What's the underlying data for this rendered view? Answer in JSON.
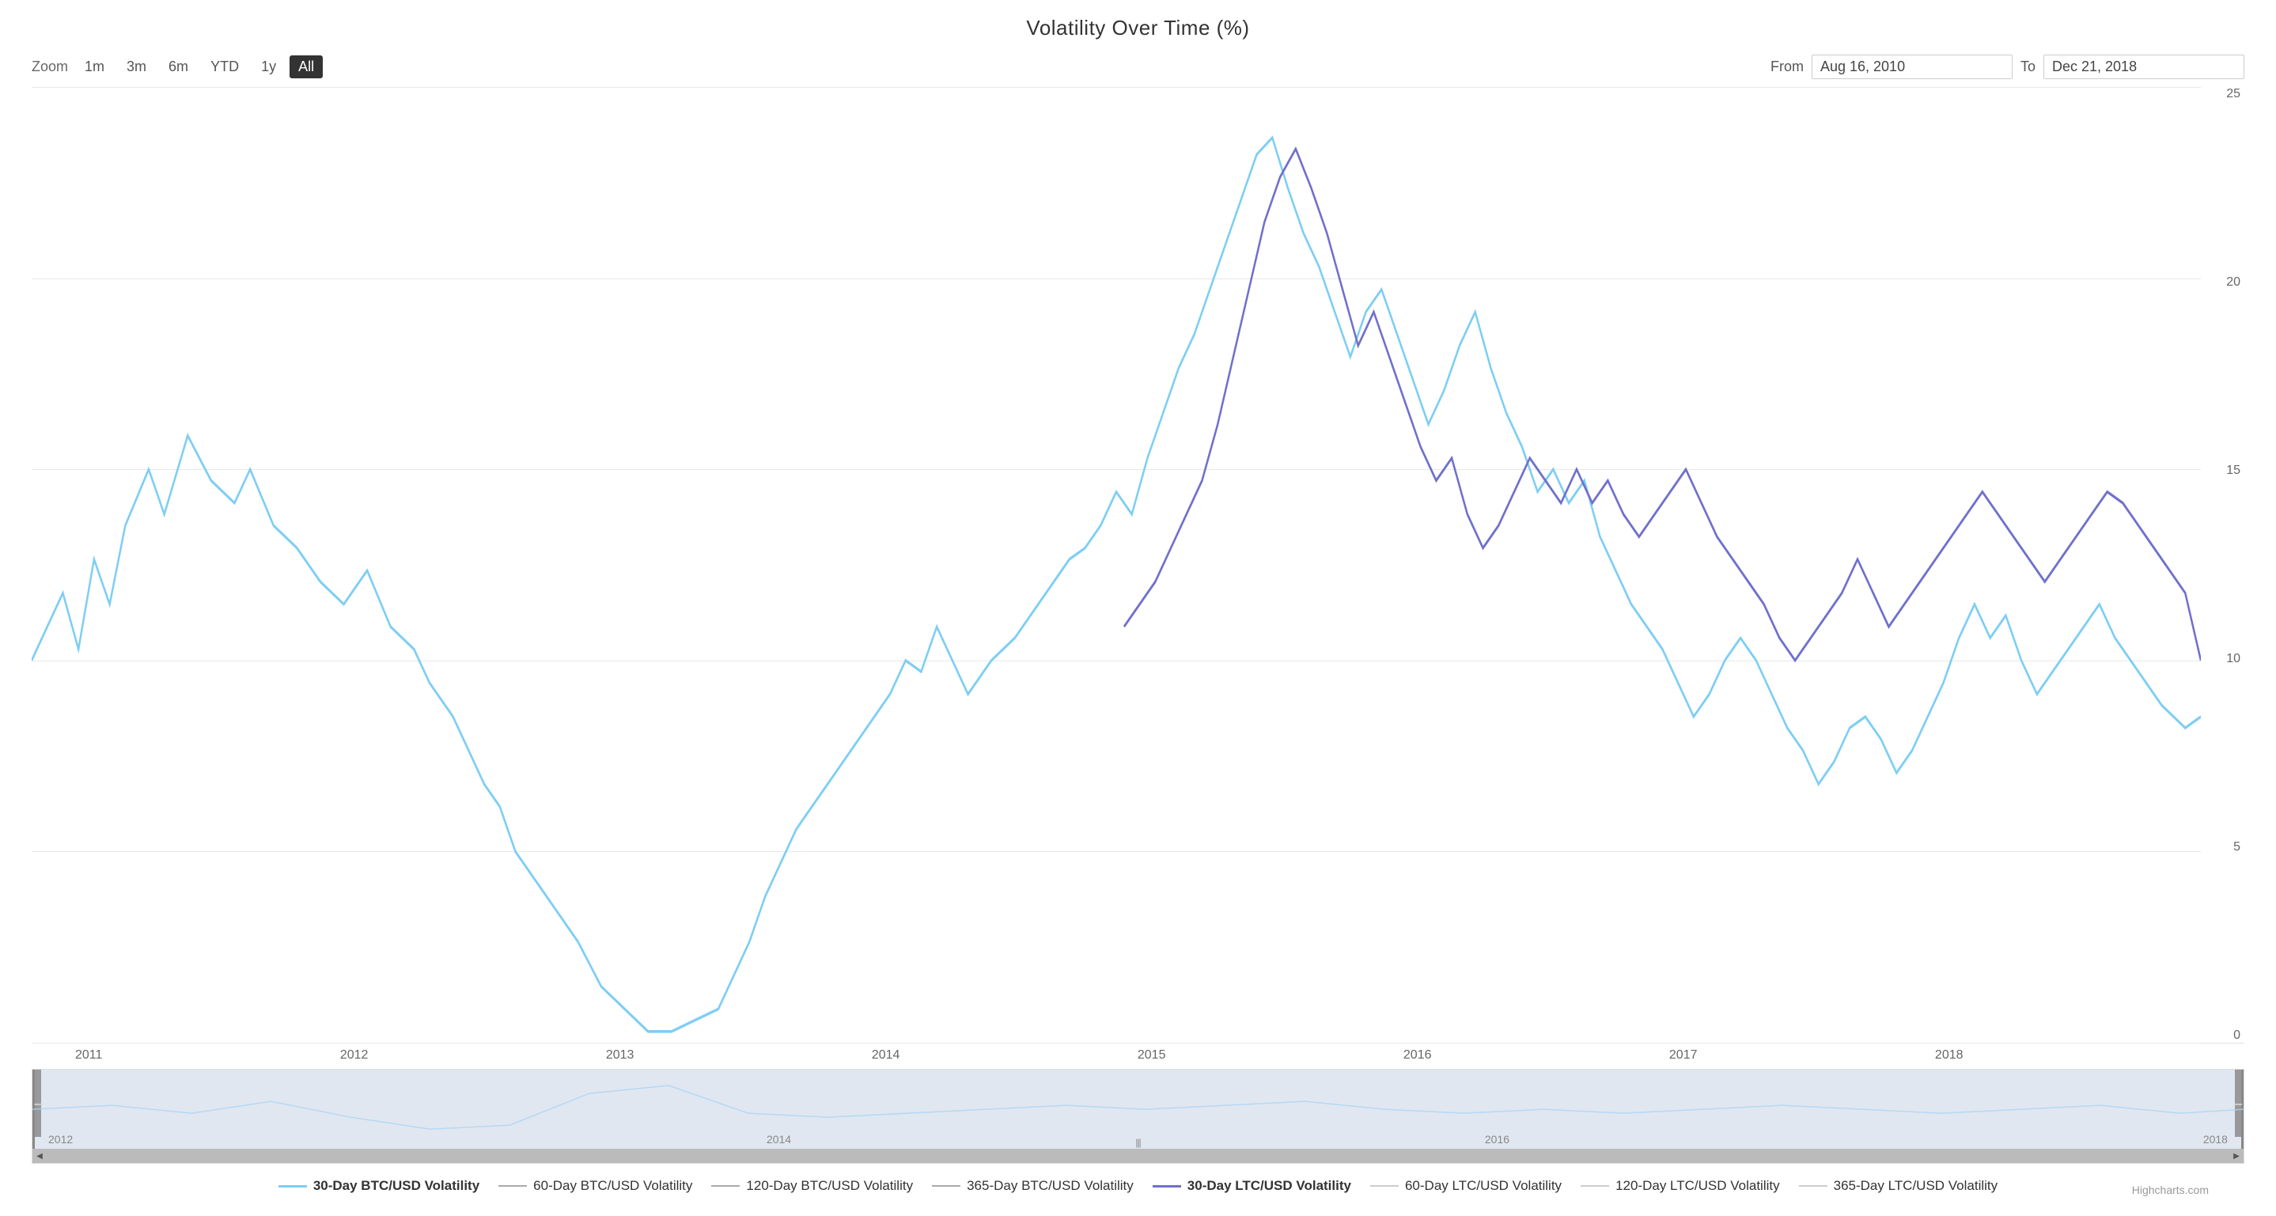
{
  "title": "Volatility Over Time (%)",
  "toolbar": {
    "zoom_label": "Zoom",
    "zoom_buttons": [
      "1m",
      "3m",
      "6m",
      "YTD",
      "1y",
      "All"
    ],
    "active_zoom": "All",
    "from_label": "From",
    "to_label": "To",
    "from_date": "Aug 16, 2010",
    "to_date": "Dec 21, 2018"
  },
  "y_axis": {
    "labels": [
      "25",
      "20",
      "15",
      "10",
      "5",
      "0"
    ]
  },
  "x_axis": {
    "labels": [
      "2011",
      "2012",
      "2013",
      "2014",
      "2015",
      "2016",
      "2017",
      "2018",
      ""
    ]
  },
  "navigator": {
    "x_labels": [
      "2012",
      "2014",
      "2016",
      "2018"
    ]
  },
  "legend": [
    {
      "id": "btc30",
      "label": "30-Day BTC/USD Volatility",
      "color": "#7ecef4",
      "bold": true
    },
    {
      "id": "btc60",
      "label": "60-Day BTC/USD Volatility",
      "color": "#aaaaaa",
      "bold": false
    },
    {
      "id": "btc120",
      "label": "120-Day BTC/USD Volatility",
      "color": "#aaaaaa",
      "bold": false
    },
    {
      "id": "btc365",
      "label": "365-Day BTC/USD Volatility",
      "color": "#aaaaaa",
      "bold": false
    },
    {
      "id": "ltc30",
      "label": "30-Day LTC/USD Volatility",
      "color": "#7070cc",
      "bold": true
    },
    {
      "id": "ltc60",
      "label": "60-Day LTC/USD Volatility",
      "color": "#cccccc",
      "bold": false
    },
    {
      "id": "ltc120",
      "label": "120-Day LTC/USD Volatility",
      "color": "#cccccc",
      "bold": false
    },
    {
      "id": "ltc365",
      "label": "365-Day LTC/USD Volatility",
      "color": "#cccccc",
      "bold": false
    }
  ],
  "credit": "Highcharts.com"
}
